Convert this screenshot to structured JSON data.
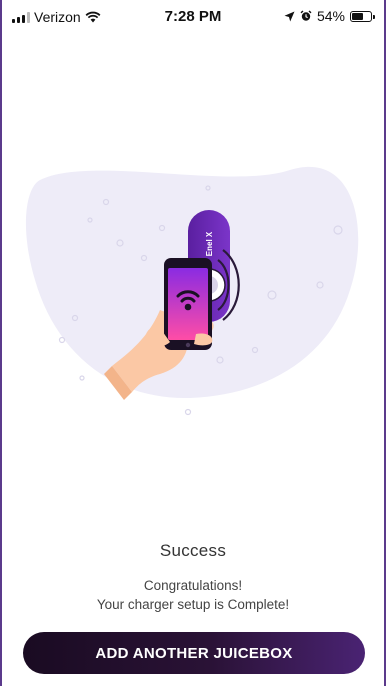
{
  "status_bar": {
    "carrier": "Verizon",
    "time": "7:28 PM",
    "battery": "54%",
    "battery_level": 0.54
  },
  "illustration": {
    "device_label": "Enel X",
    "colors": {
      "blob": "#eeecf8",
      "device": "#6a2bb3",
      "phone_gradient_top": "#8a2be2",
      "phone_gradient_bottom": "#ff4da6"
    }
  },
  "main": {
    "title": "Success",
    "message_line1": "Congratulations!",
    "message_line2": "Your charger setup is Complete!"
  },
  "actions": {
    "add_another_label": "ADD ANOTHER JUICEBOX"
  }
}
